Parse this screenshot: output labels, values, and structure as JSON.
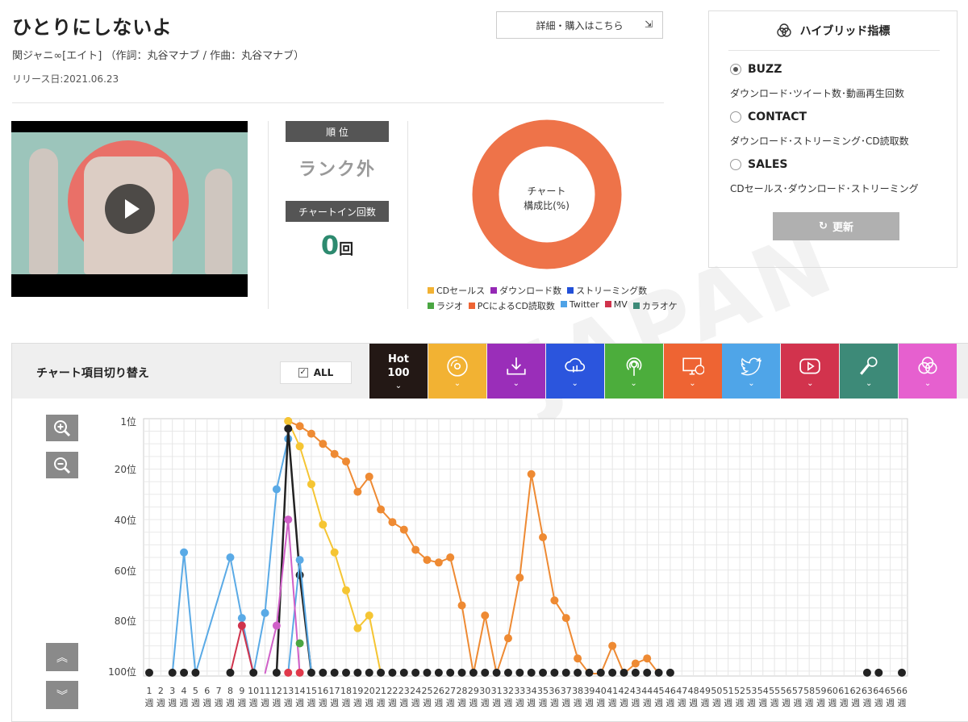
{
  "song": {
    "title": "ひとりにしないよ",
    "artist": "関ジャニ∞[エイト] （作詞：丸谷マナブ / 作曲：丸谷マナブ）",
    "release": "リリース日:2021.06.23",
    "buy_label": "詳細・購入はこちら"
  },
  "rank": {
    "header": "順 位",
    "value": "ランク外"
  },
  "chartin": {
    "header": "チャートイン回数",
    "count": "0",
    "unit": "回"
  },
  "composition": {
    "label_line1": "チャート",
    "label_line2": "構成比(%)",
    "color": "#ee7349"
  },
  "legend": [
    {
      "label": "CDセールス",
      "color": "#f2b233"
    },
    {
      "label": "ダウンロード数",
      "color": "#9528b5"
    },
    {
      "label": "ストリーミング数",
      "color": "#2250d8"
    },
    {
      "label": "ラジオ",
      "color": "#4aa642"
    },
    {
      "label": "PCによるCD読取数",
      "color": "#ee6433"
    },
    {
      "label": "Twitter",
      "color": "#4fa2e6"
    },
    {
      "label": "MV",
      "color": "#d0334c"
    },
    {
      "label": "カラオケ",
      "color": "#3d8a78"
    }
  ],
  "hybrid": {
    "title": "ハイブリッド指標",
    "options": [
      {
        "label": "BUZZ",
        "desc": "ダウンロード･ツイート数･動画再生回数",
        "selected": true
      },
      {
        "label": "CONTACT",
        "desc": "ダウンロード･ストリーミング･CD読取数",
        "selected": false
      },
      {
        "label": "SALES",
        "desc": "CDセールス･ダウンロード･ストリーミング",
        "selected": false
      }
    ],
    "update_label": "更新"
  },
  "switcher": {
    "title": "チャート項目切り替え",
    "all_label": "ALL",
    "hot_line1": "Hot",
    "hot_line2": "100",
    "tabs": [
      {
        "icon": "hot100-icon",
        "color": "#231815"
      },
      {
        "icon": "cd-icon",
        "color": "#f2b233"
      },
      {
        "icon": "download-icon",
        "color": "#9a2eb9"
      },
      {
        "icon": "streaming-icon",
        "color": "#2b55dd"
      },
      {
        "icon": "radio-icon",
        "color": "#4cad3c"
      },
      {
        "icon": "pc-cd-icon",
        "color": "#ee6433"
      },
      {
        "icon": "twitter-icon",
        "color": "#4fa5e8"
      },
      {
        "icon": "youtube-icon",
        "color": "#d2334d"
      },
      {
        "icon": "karaoke-mic-icon",
        "color": "#3d8a78"
      },
      {
        "icon": "hybrid-icon",
        "color": "#e660cf"
      }
    ]
  },
  "chart_data": {
    "type": "line",
    "y_labels": [
      "1位",
      "20位",
      "40位",
      "60位",
      "80位",
      "100位"
    ],
    "x": [
      1,
      2,
      3,
      4,
      5,
      6,
      7,
      8,
      9,
      10,
      11,
      12,
      13,
      14,
      15,
      16,
      17,
      18,
      19,
      20,
      21,
      22,
      23,
      24,
      25,
      26,
      27,
      28,
      29,
      30,
      31,
      32,
      33,
      34,
      35,
      36,
      37,
      38,
      39,
      40,
      41,
      42,
      43,
      44,
      45,
      46,
      47,
      48,
      49,
      50,
      51,
      52,
      53,
      54,
      55,
      56,
      57,
      58,
      59,
      60,
      61,
      62,
      63,
      64,
      65,
      66
    ],
    "x_unit": "週",
    "ylim": [
      1,
      100
    ],
    "y_reversed": true,
    "series": [
      {
        "key": "pc_cd",
        "color": "#ee8a33",
        "points": [
          [
            13,
            1
          ],
          [
            14,
            3
          ],
          [
            15,
            6
          ],
          [
            16,
            10
          ],
          [
            17,
            14
          ],
          [
            18,
            17
          ],
          [
            19,
            29
          ],
          [
            20,
            23
          ],
          [
            21,
            36
          ],
          [
            22,
            41
          ],
          [
            23,
            44
          ],
          [
            24,
            52
          ],
          [
            25,
            56
          ],
          [
            26,
            57
          ],
          [
            27,
            55
          ],
          [
            28,
            74
          ],
          [
            29,
            101
          ],
          [
            30,
            78
          ],
          [
            31,
            101
          ],
          [
            32,
            87
          ],
          [
            33,
            63
          ],
          [
            34,
            22
          ],
          [
            35,
            47
          ],
          [
            36,
            72
          ],
          [
            37,
            79
          ],
          [
            38,
            95
          ],
          [
            39,
            101
          ],
          [
            40,
            101
          ],
          [
            41,
            90
          ],
          [
            42,
            101
          ],
          [
            43,
            97
          ],
          [
            44,
            95
          ],
          [
            45,
            101
          ]
        ]
      },
      {
        "key": "cd",
        "color": "#f5c533",
        "points": [
          [
            13,
            1
          ],
          [
            14,
            11
          ],
          [
            15,
            26
          ],
          [
            16,
            42
          ],
          [
            17,
            53
          ],
          [
            18,
            68
          ],
          [
            19,
            83
          ],
          [
            20,
            78
          ],
          [
            21,
            101
          ]
        ]
      },
      {
        "key": "twitter",
        "color": "#5aaae6",
        "points": [
          [
            3,
            101
          ],
          [
            4,
            53
          ],
          [
            5,
            101
          ],
          [
            8,
            55
          ],
          [
            9,
            79
          ],
          [
            10,
            101
          ],
          [
            11,
            77
          ],
          [
            12,
            28
          ],
          [
            13,
            8
          ]
        ]
      },
      {
        "key": "hot100",
        "color": "#222222",
        "points": [
          [
            12,
            101
          ],
          [
            13,
            4
          ],
          [
            14,
            62
          ],
          [
            15,
            101
          ]
        ]
      },
      {
        "key": "streaming",
        "color": "#5aaae6",
        "points": [
          [
            13,
            101
          ],
          [
            14,
            56
          ],
          [
            15,
            101
          ]
        ]
      },
      {
        "key": "mv",
        "color": "#d0334c",
        "points": [
          [
            8,
            101
          ],
          [
            9,
            82
          ],
          [
            10,
            101
          ]
        ]
      },
      {
        "key": "karaoke",
        "color": "#d060c8",
        "points": [
          [
            11,
            101
          ],
          [
            12,
            82
          ],
          [
            13,
            40
          ],
          [
            14,
            101
          ]
        ]
      },
      {
        "key": "radio",
        "color": "#4aa642",
        "points": [
          [
            14,
            89
          ]
        ]
      }
    ],
    "baseline_black_weeks": [
      1,
      3,
      4,
      5,
      8,
      10,
      12,
      15,
      16,
      17,
      18,
      19,
      20,
      21,
      22,
      23,
      24,
      25,
      26,
      27,
      28,
      29,
      30,
      31,
      32,
      33,
      34,
      35,
      36,
      37,
      38,
      39,
      40,
      41,
      42,
      43,
      44,
      45,
      46,
      63,
      64,
      66
    ],
    "baseline_red_weeks": [
      13,
      14
    ]
  }
}
